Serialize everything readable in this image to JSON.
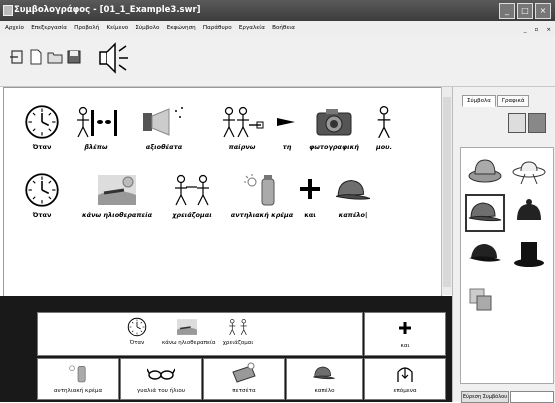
{
  "window": {
    "title": "Συμβολογράφος - [01_1_Example3.swr]"
  },
  "menu": [
    "Αρχείο",
    "Επεξεργασία",
    "Προβολή",
    "Κείμενο",
    "Σύμβολο",
    "Εκφώνηση",
    "Παράθυρο",
    "Εργαλεία",
    "Βοήθεια"
  ],
  "document": {
    "row1": [
      "Όταν",
      "βλέπω",
      "αξιοθέατα",
      "παίρνω",
      "τη",
      "φωτογραφική",
      "μου."
    ],
    "row2": [
      "Όταν",
      "κάνω ηλιοθεραπεία",
      "χρειάζομαι",
      "αντηλιακή κρέμα",
      "και",
      "καπέλο|"
    ]
  },
  "right_panel": {
    "tabs": [
      "Σύμβολα",
      "Γραφικά"
    ],
    "search_button": "Εύρεση Συμβόλου"
  },
  "bottom_panel": {
    "phrase_words": [
      "Όταν",
      "κάνω ηλιοθεραπεία",
      "χρειάζομαι"
    ],
    "plus_label": "και",
    "cards": [
      "αντηλιακή κρέμα",
      "γυαλιά του ήλιου",
      "πετσέτα",
      "καπέλο",
      "επόμενα"
    ]
  },
  "colors": {
    "titlebar": "#4a4a4a",
    "bottom_panel_bg": "#191919",
    "camera": "#555555"
  },
  "icons": [
    "clock-icon",
    "look-icon",
    "sights-icon",
    "take-icon",
    "arrow-icon",
    "camera-icon",
    "person-icon",
    "sunbathe-icon",
    "need-icon",
    "sunscreen-icon",
    "plus-icon",
    "cap-icon",
    "speaker-icon"
  ]
}
